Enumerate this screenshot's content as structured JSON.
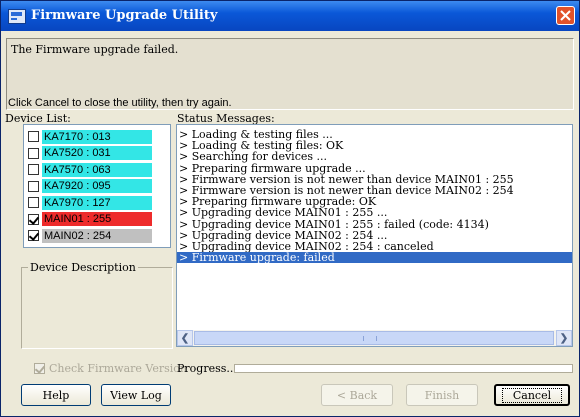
{
  "window": {
    "title": "Firmware Upgrade Utility"
  },
  "message": {
    "text": "The Firmware upgrade failed.",
    "instruction": "Click Cancel to close the utility, then try again."
  },
  "device_list": {
    "label": "Device List:",
    "items": [
      {
        "name": "KA7170 : 013",
        "checked": false,
        "color": "#33e6e6"
      },
      {
        "name": "KA7520 : 031",
        "checked": false,
        "color": "#33e6e6"
      },
      {
        "name": "KA7570 : 063",
        "checked": false,
        "color": "#33e6e6"
      },
      {
        "name": "KA7920 : 095",
        "checked": false,
        "color": "#33e6e6"
      },
      {
        "name": "KA7970 : 127",
        "checked": false,
        "color": "#33e6e6"
      },
      {
        "name": "MAIN01 : 255",
        "checked": true,
        "color": "#ee2b2b"
      },
      {
        "name": "MAIN02 : 254",
        "checked": true,
        "color": "#c0c0c0"
      }
    ]
  },
  "device_description": {
    "label": "Device Description"
  },
  "status": {
    "label": "Status Messages:",
    "lines": [
      "> Loading & testing files ...",
      "> Loading & testing files: OK",
      "> Searching for devices ...",
      "> Preparing firmware upgrade ...",
      "> Firmware version is not newer than device MAIN01 : 255",
      "> Firmware version is not newer than device MAIN02 : 254",
      "> Preparing firmware upgrade: OK",
      "> Upgrading device MAIN01 : 255 ...",
      "> Upgrading device MAIN01 : 255 : failed (code: 4134)",
      "> Upgrading device MAIN02 : 254 ...",
      "> Upgrading device MAIN02 : 254 : canceled",
      "> Firmware upgrade: failed"
    ],
    "selected_line": 11
  },
  "footer": {
    "check_firmware_label": "Check Firmware Version",
    "check_firmware_checked": true,
    "progress_label": "Progress...",
    "progress_value": 0
  },
  "buttons": {
    "help": "Help",
    "view_log": "View Log",
    "back": "< Back",
    "finish": "Finish",
    "cancel": "Cancel"
  },
  "colors": {
    "titlebar": "#0a58d8",
    "selection": "#316ac5"
  }
}
